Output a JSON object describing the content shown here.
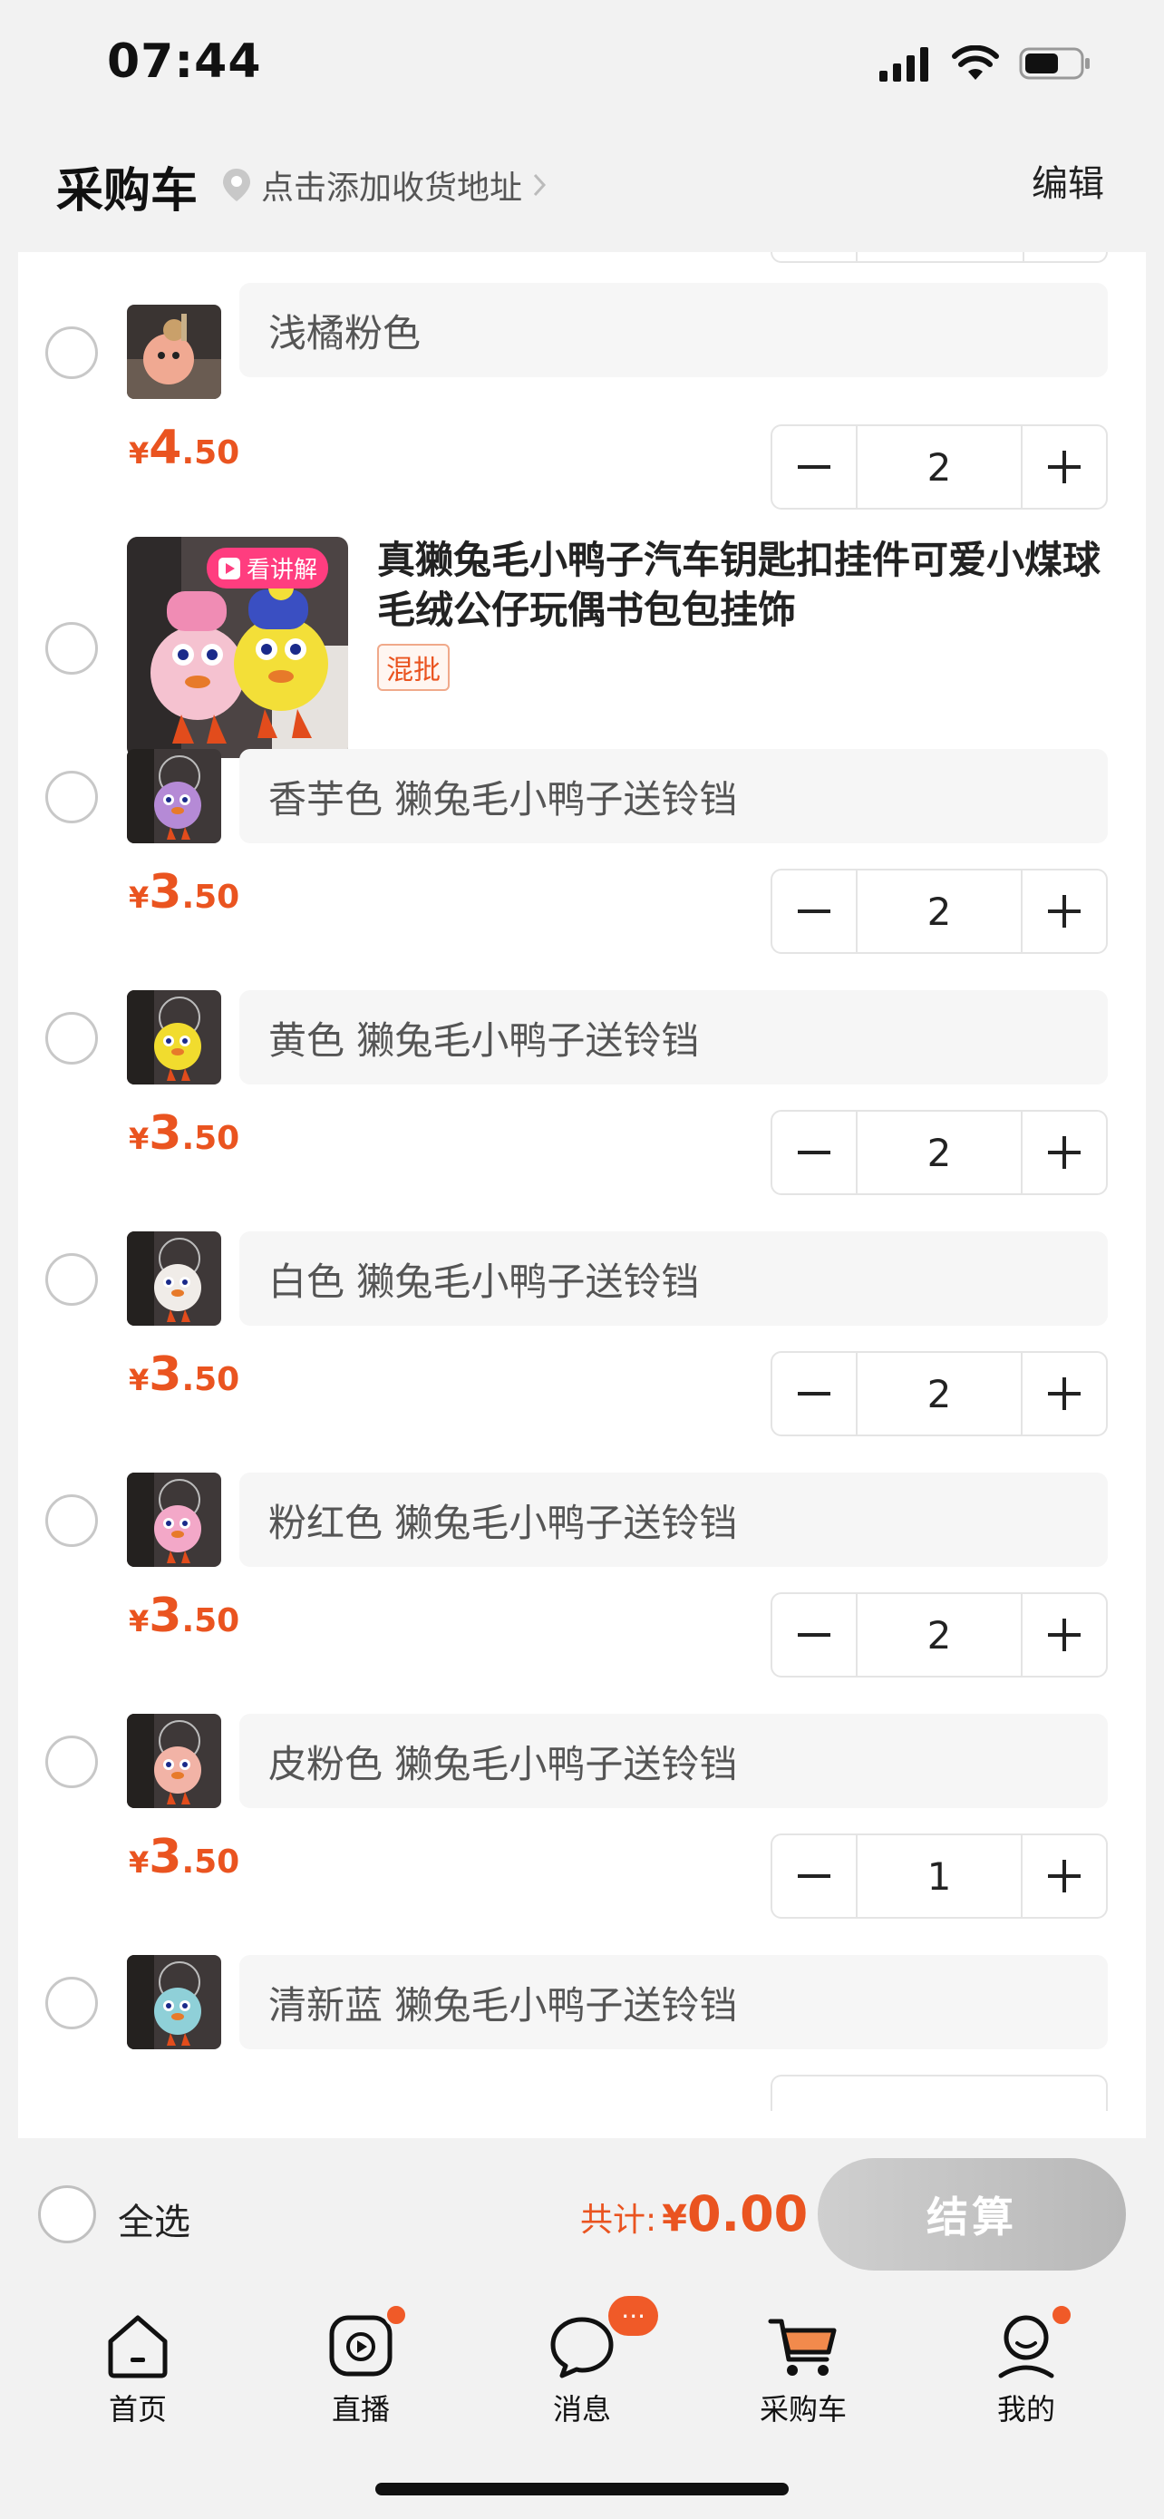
{
  "status_bar": {
    "time": "07:44"
  },
  "header": {
    "title": "采购车",
    "address": "点击添加收货地址",
    "edit": "编辑"
  },
  "colors": {
    "accent": "#ea5420",
    "badge": "#f05a28",
    "live": "#ff3d7f"
  },
  "items_top": {
    "variant": "浅橘粉色",
    "price_currency": "¥",
    "price_int": "4",
    "price_dec": ".50",
    "qty": "2"
  },
  "product": {
    "title": "真獭兔毛小鸭子汽车钥匙扣挂件可爱小煤球毛绒公仔玩偶书包包挂饰",
    "live_badge": "看讲解",
    "tag": "混批",
    "variants": [
      {
        "name": "香芋色 獭兔毛小鸭子送铃铛",
        "currency": "¥",
        "int": "3",
        "dec": ".50",
        "qty": "2",
        "color": "#b58ad6"
      },
      {
        "name": "黄色 獭兔毛小鸭子送铃铛",
        "currency": "¥",
        "int": "3",
        "dec": ".50",
        "qty": "2",
        "color": "#f1dc2e"
      },
      {
        "name": "白色 獭兔毛小鸭子送铃铛",
        "currency": "¥",
        "int": "3",
        "dec": ".50",
        "qty": "2",
        "color": "#f0ece8"
      },
      {
        "name": "粉红色 獭兔毛小鸭子送铃铛",
        "currency": "¥",
        "int": "3",
        "dec": ".50",
        "qty": "2",
        "color": "#f3a8c8"
      },
      {
        "name": "皮粉色 獭兔毛小鸭子送铃铛",
        "currency": "¥",
        "int": "3",
        "dec": ".50",
        "qty": "1",
        "color": "#f2b3a6"
      },
      {
        "name": "清新蓝 獭兔毛小鸭子送铃铛",
        "color": "#8fd0d8"
      }
    ]
  },
  "checkout": {
    "select_all": "全选",
    "total_label": "共计:",
    "currency": "¥",
    "total": "0.00",
    "button": "结算"
  },
  "tabs": [
    {
      "label": "首页",
      "icon": "home-icon"
    },
    {
      "label": "直播",
      "icon": "live-icon"
    },
    {
      "label": "消息",
      "icon": "message-icon",
      "badge": "···"
    },
    {
      "label": "采购车",
      "icon": "cart-icon"
    },
    {
      "label": "我的",
      "icon": "profile-icon"
    }
  ]
}
